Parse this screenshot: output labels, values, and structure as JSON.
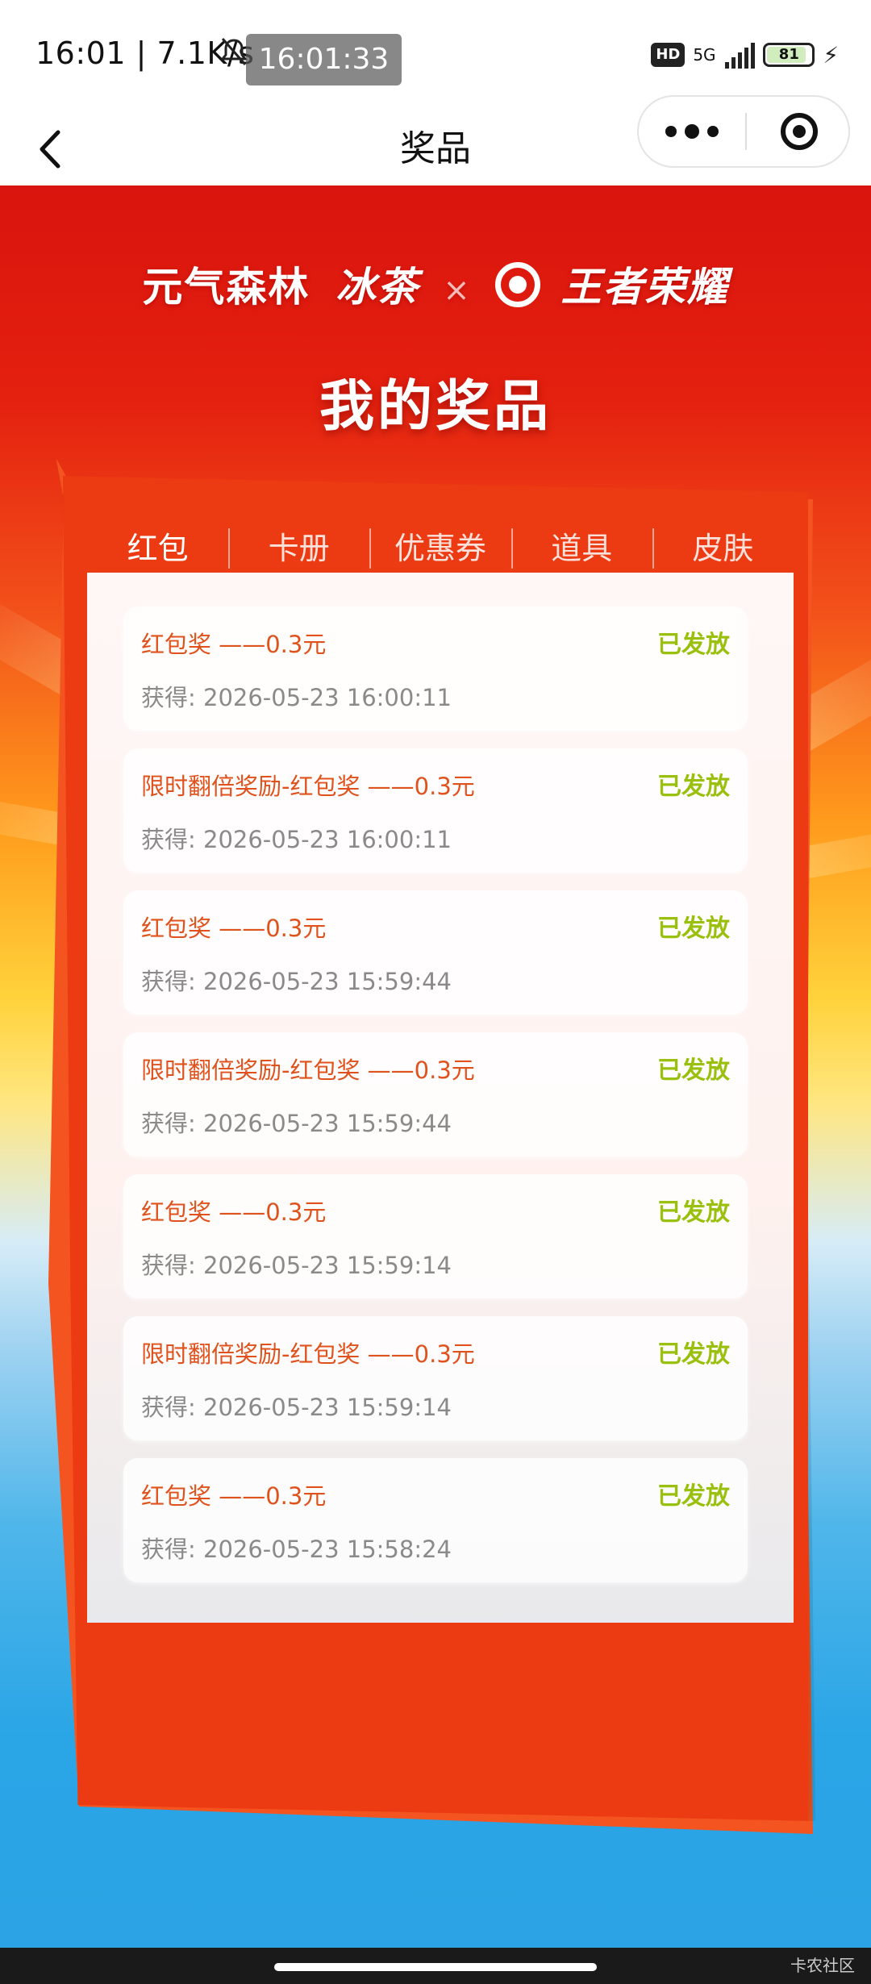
{
  "status_bar": {
    "left_text": "16:01 | 7.1K/s",
    "time_overlay": "16:01:33",
    "hd": "HD",
    "network": "5G",
    "battery": "81"
  },
  "nav": {
    "title": "奖品"
  },
  "hero": {
    "brand_left": "元气森林",
    "brand_mid": "冰茶",
    "brand_sep": "×",
    "brand_right": "王者荣耀",
    "heading": "我的奖品"
  },
  "tabs": [
    {
      "label": "红包",
      "active": true
    },
    {
      "label": "卡册",
      "active": false
    },
    {
      "label": "优惠券",
      "active": false
    },
    {
      "label": "道具",
      "active": false
    },
    {
      "label": "皮肤",
      "active": false
    }
  ],
  "prizes": [
    {
      "title": "红包奖 ——0.3元",
      "time": "获得: 2026-05-23 16:00:11",
      "status": "已发放"
    },
    {
      "title": "限时翻倍奖励-红包奖 ——0.3元",
      "time": "获得: 2026-05-23 16:00:11",
      "status": "已发放"
    },
    {
      "title": "红包奖 ——0.3元",
      "time": "获得: 2026-05-23 15:59:44",
      "status": "已发放"
    },
    {
      "title": "限时翻倍奖励-红包奖 ——0.3元",
      "time": "获得: 2026-05-23 15:59:44",
      "status": "已发放"
    },
    {
      "title": "红包奖 ——0.3元",
      "time": "获得: 2026-05-23 15:59:14",
      "status": "已发放"
    },
    {
      "title": "限时翻倍奖励-红包奖 ——0.3元",
      "time": "获得: 2026-05-23 15:59:14",
      "status": "已发放"
    },
    {
      "title": "红包奖 ——0.3元",
      "time": "获得: 2026-05-23 15:58:24",
      "status": "已发放"
    }
  ],
  "watermark": "卡农社区",
  "colors": {
    "header_red": "#d9140e",
    "frame_red": "#ec3a12",
    "prize_orange": "#e0521c",
    "status_green": "#9ac00e",
    "time_gray": "#8a8a8a"
  }
}
